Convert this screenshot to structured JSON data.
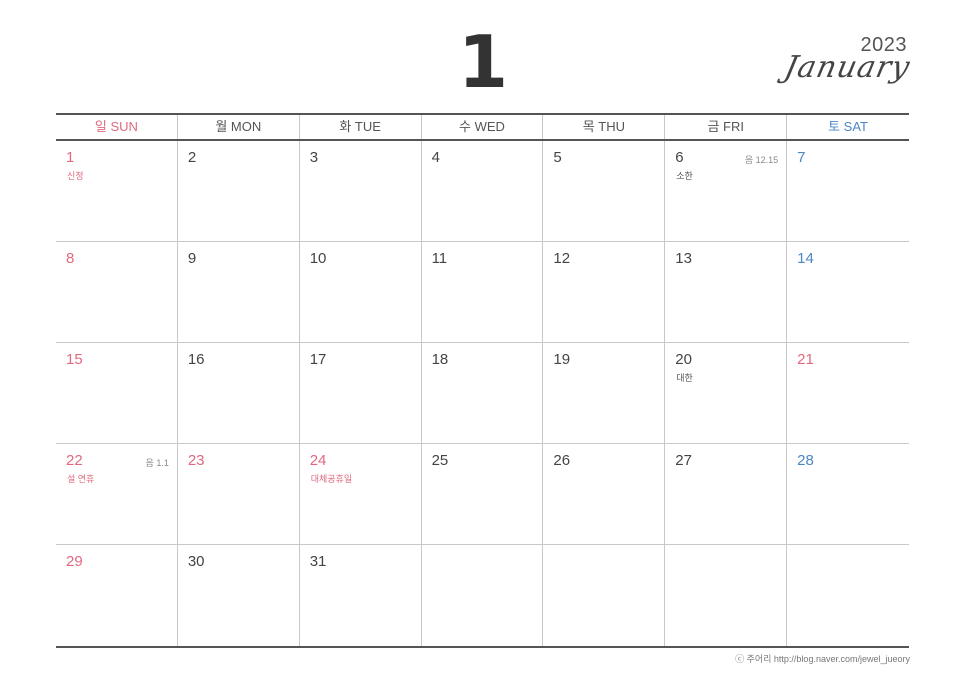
{
  "month_number": "1",
  "year": "2023",
  "month_name": "January",
  "colors": {
    "sunday_holiday": "#e0697e",
    "saturday": "#4d86c4",
    "text": "#444444",
    "grid": "#c8c8c8"
  },
  "weekdays": [
    {
      "label": "일 SUN",
      "type": "sun"
    },
    {
      "label": "월 MON",
      "type": "weekday"
    },
    {
      "label": "화 TUE",
      "type": "weekday"
    },
    {
      "label": "수 WED",
      "type": "weekday"
    },
    {
      "label": "목 THU",
      "type": "weekday"
    },
    {
      "label": "금 FRI",
      "type": "weekday"
    },
    {
      "label": "토 SAT",
      "type": "sat"
    }
  ],
  "weeks": [
    [
      {
        "day": "1",
        "note": "신정",
        "holiday": true
      },
      {
        "day": "2"
      },
      {
        "day": "3"
      },
      {
        "day": "4"
      },
      {
        "day": "5"
      },
      {
        "day": "6",
        "note": "소한",
        "lunar": "음 12.15"
      },
      {
        "day": "7"
      }
    ],
    [
      {
        "day": "8"
      },
      {
        "day": "9"
      },
      {
        "day": "10"
      },
      {
        "day": "11"
      },
      {
        "day": "12"
      },
      {
        "day": "13"
      },
      {
        "day": "14"
      }
    ],
    [
      {
        "day": "15"
      },
      {
        "day": "16"
      },
      {
        "day": "17"
      },
      {
        "day": "18"
      },
      {
        "day": "19"
      },
      {
        "day": "20",
        "note": "대한"
      },
      {
        "day": "21",
        "holiday": true
      }
    ],
    [
      {
        "day": "22",
        "note": "설 연휴",
        "lunar": "음 1.1",
        "holiday": true
      },
      {
        "day": "23",
        "holiday": true
      },
      {
        "day": "24",
        "note": "대체공휴일",
        "holiday": true
      },
      {
        "day": "25"
      },
      {
        "day": "26"
      },
      {
        "day": "27"
      },
      {
        "day": "28"
      }
    ],
    [
      {
        "day": "29"
      },
      {
        "day": "30"
      },
      {
        "day": "31"
      },
      {
        "day": ""
      },
      {
        "day": ""
      },
      {
        "day": ""
      },
      {
        "day": ""
      }
    ]
  ],
  "credit": "ⓒ 주어리 http://blog.naver.com/jewel_jueory"
}
